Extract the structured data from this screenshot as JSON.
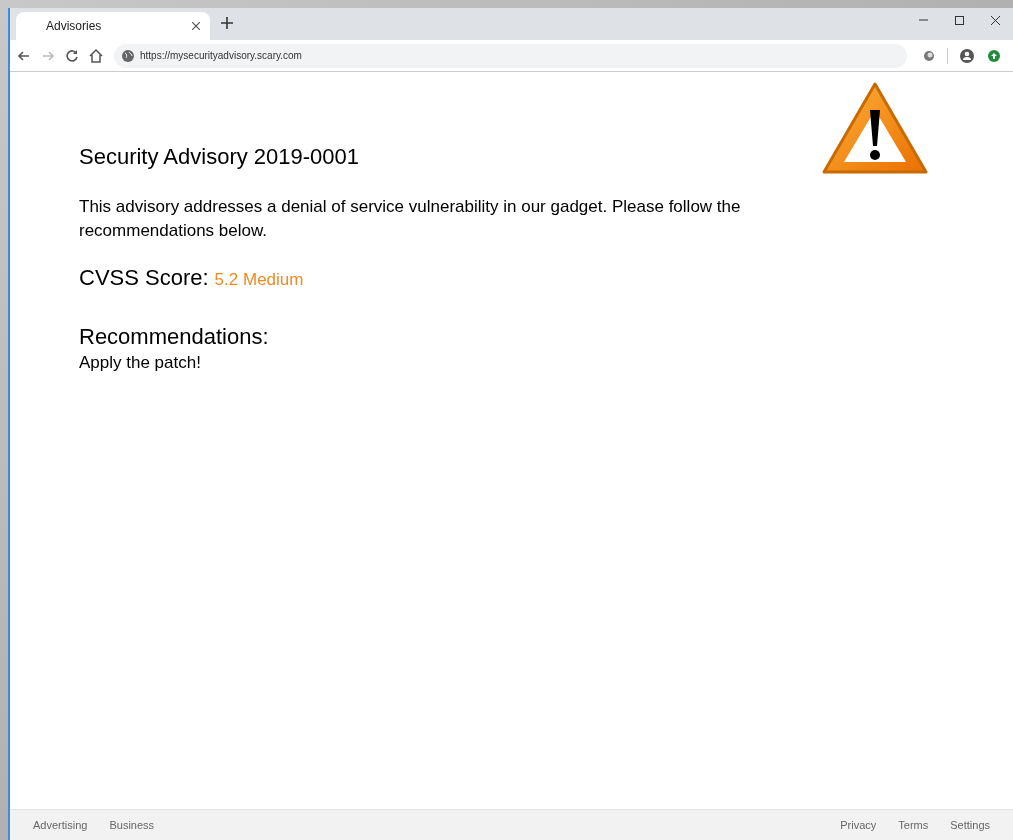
{
  "tabs": [
    {
      "title": "Advisories",
      "selected": true
    }
  ],
  "address_bar": {
    "url": "https://mysecurityadvisory.scary.com"
  },
  "page": {
    "title": "Security Advisory 2019-0001",
    "intro": "This advisory addresses a denial of service vulnerability in our gadget. Please follow the recommendations below.",
    "cvss": {
      "label": "CVSS Score:",
      "value": "5.2 Medium",
      "color": "#f08a24"
    },
    "recommendations": {
      "heading": "Recommendations:",
      "text": "Apply the patch!"
    }
  },
  "footer": {
    "left": [
      "Advertising",
      "Business"
    ],
    "right": [
      "Privacy",
      "Terms",
      "Settings"
    ]
  }
}
